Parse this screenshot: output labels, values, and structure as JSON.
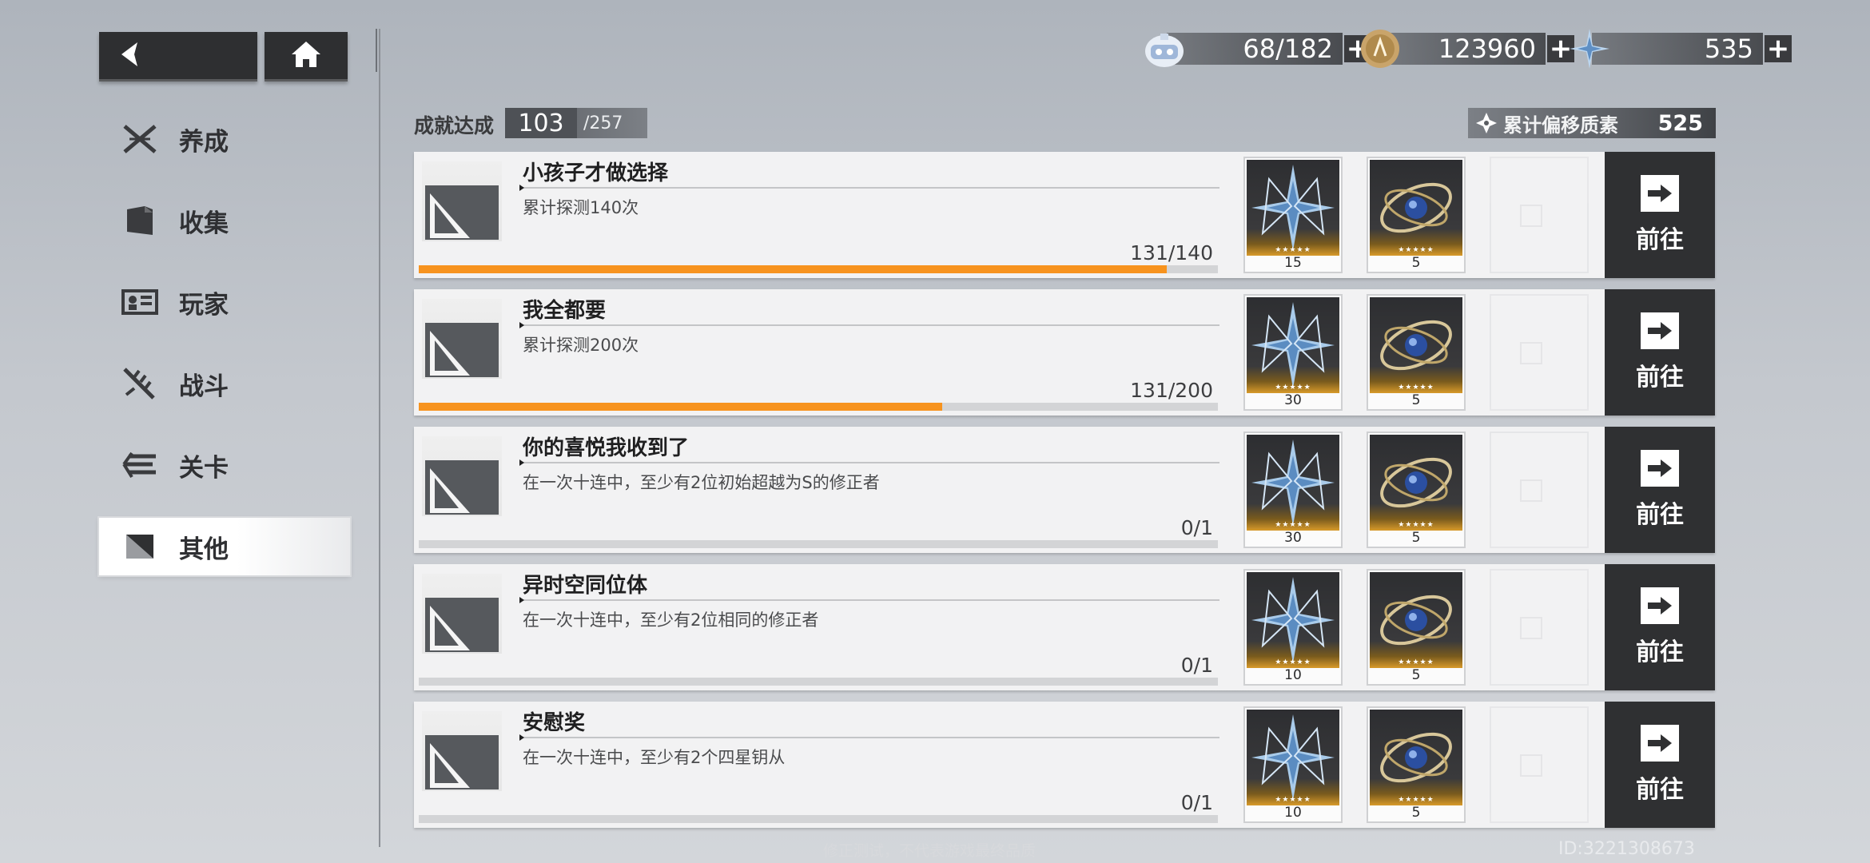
{
  "nav": {
    "back_icon": "back-arrow-icon",
    "home_icon": "home-icon"
  },
  "resources": [
    {
      "icon": "robot-ticket-icon",
      "value": "68/182"
    },
    {
      "icon": "coin-icon",
      "value": "123960"
    },
    {
      "icon": "crystal-star-icon",
      "value": "535"
    }
  ],
  "sidebar": {
    "items": [
      {
        "label": "养成",
        "icon": "crossed-swords-icon",
        "active": false
      },
      {
        "label": "收集",
        "icon": "folder-icon",
        "active": false
      },
      {
        "label": "玩家",
        "icon": "id-card-icon",
        "active": false
      },
      {
        "label": "战斗",
        "icon": "blade-icon",
        "active": false
      },
      {
        "label": "关卡",
        "icon": "stage-icon",
        "active": false
      },
      {
        "label": "其他",
        "icon": "other-icon",
        "active": true
      }
    ]
  },
  "header": {
    "achievement_label": "成就达成",
    "achievement_current": "103",
    "achievement_total": "/257",
    "drift_label": "累计偏移质素",
    "drift_value": "525"
  },
  "achievements": [
    {
      "title": "小孩子才做选择",
      "desc": "累计探测140次",
      "count": "131/140",
      "progress": 0.936,
      "rewards": [
        "15",
        "5"
      ],
      "go": "前往"
    },
    {
      "title": "我全都要",
      "desc": "累计探测200次",
      "count": "131/200",
      "progress": 0.655,
      "rewards": [
        "30",
        "5"
      ],
      "go": "前往"
    },
    {
      "title": "你的喜悦我收到了",
      "desc": "在一次十连中，至少有2位初始超越为S的修正者",
      "count": "0/1",
      "progress": 0,
      "rewards": [
        "30",
        "5"
      ],
      "go": "前往"
    },
    {
      "title": "异时空同位体",
      "desc": "在一次十连中，至少有2位相同的修正者",
      "count": "0/1",
      "progress": 0,
      "rewards": [
        "10",
        "5"
      ],
      "go": "前往"
    },
    {
      "title": "安慰奖",
      "desc": "在一次十连中，至少有2个四星钥从",
      "count": "0/1",
      "progress": 0,
      "rewards": [
        "10",
        "5"
      ],
      "go": "前往"
    }
  ],
  "footer": {
    "note": "修正测试，不代表游戏最终品质",
    "id": "ID:3221308673"
  },
  "colors": {
    "progress": "#f7931e",
    "dark_button": "#2f3032"
  }
}
